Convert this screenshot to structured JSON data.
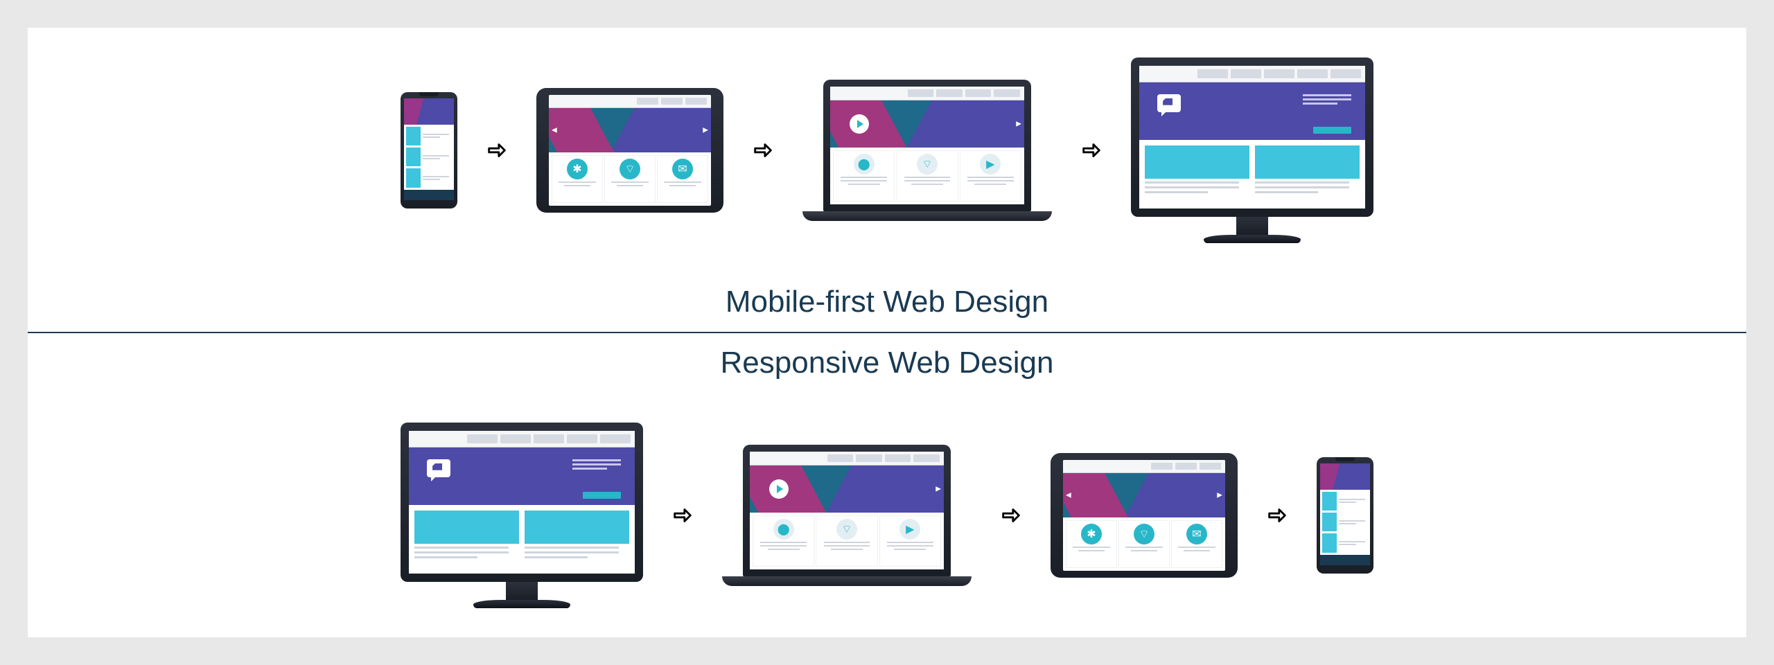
{
  "diagram": {
    "top_label": "Mobile-first Web Design",
    "bottom_label": "Responsive Web Design",
    "top_sequence": [
      "phone",
      "tablet",
      "laptop",
      "desktop"
    ],
    "bottom_sequence": [
      "desktop",
      "laptop",
      "tablet",
      "phone"
    ],
    "arrow_symbol": "⇨"
  },
  "colors": {
    "background": "#e8e8e8",
    "panel": "#ffffff",
    "text": "#1a3a52",
    "hero_purple": "#4d4aa8",
    "hero_magenta": "#b82e7d",
    "hero_teal": "#1f6a8a",
    "accent_cyan": "#28b7c9",
    "card_cyan": "#3fc4dd"
  },
  "icons": {
    "tablet_circle_1": "globe-icon",
    "tablet_circle_2": "wifi-icon",
    "tablet_circle_3": "chat-icon",
    "laptop_col_1": "pin-icon",
    "laptop_col_2": "wifi-icon",
    "laptop_col_3": "play-icon",
    "hero_button": "play-icon",
    "desktop_hero": "speech-bubble-icon"
  }
}
